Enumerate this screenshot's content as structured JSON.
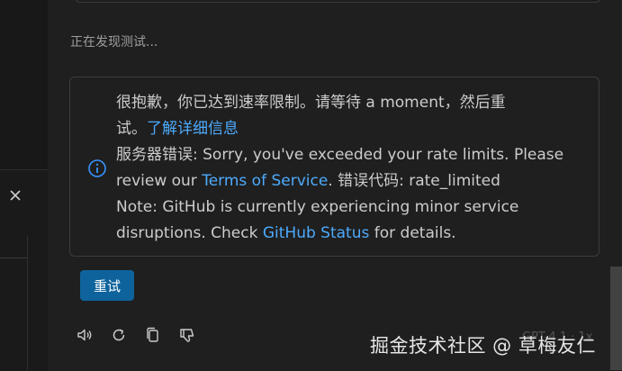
{
  "status": {
    "discovering": "正在发现测试..."
  },
  "message": {
    "line1": "很抱歉，你已达到速率限制。请等待 a moment，然后重",
    "line2_prefix": "试。",
    "learn_more": "了解详细信息",
    "server_error_prefix": "服务器错误: Sorry, you've exceeded your rate limits. Please",
    "review_prefix": "review our ",
    "terms_link": "Terms of Service",
    "error_code": ". 错误代码: rate_limited",
    "note_line": "Note: GitHub is currently experiencing minor service",
    "disruptions_prefix": "disruptions. Check ",
    "status_link": "GitHub Status",
    "details_suffix": " for details."
  },
  "retry_button": {
    "label": "重试"
  },
  "actions": [
    "speaker-icon",
    "refresh-icon",
    "copy-icon",
    "thumbs-down-icon"
  ],
  "ghost_text": "GPT-4.1 · 1x",
  "watermark": "掘金技术社区 @ 草梅友仁",
  "colors": {
    "accent": "#0e639c",
    "link": "#4daafc",
    "info_icon": "#3794ff"
  }
}
